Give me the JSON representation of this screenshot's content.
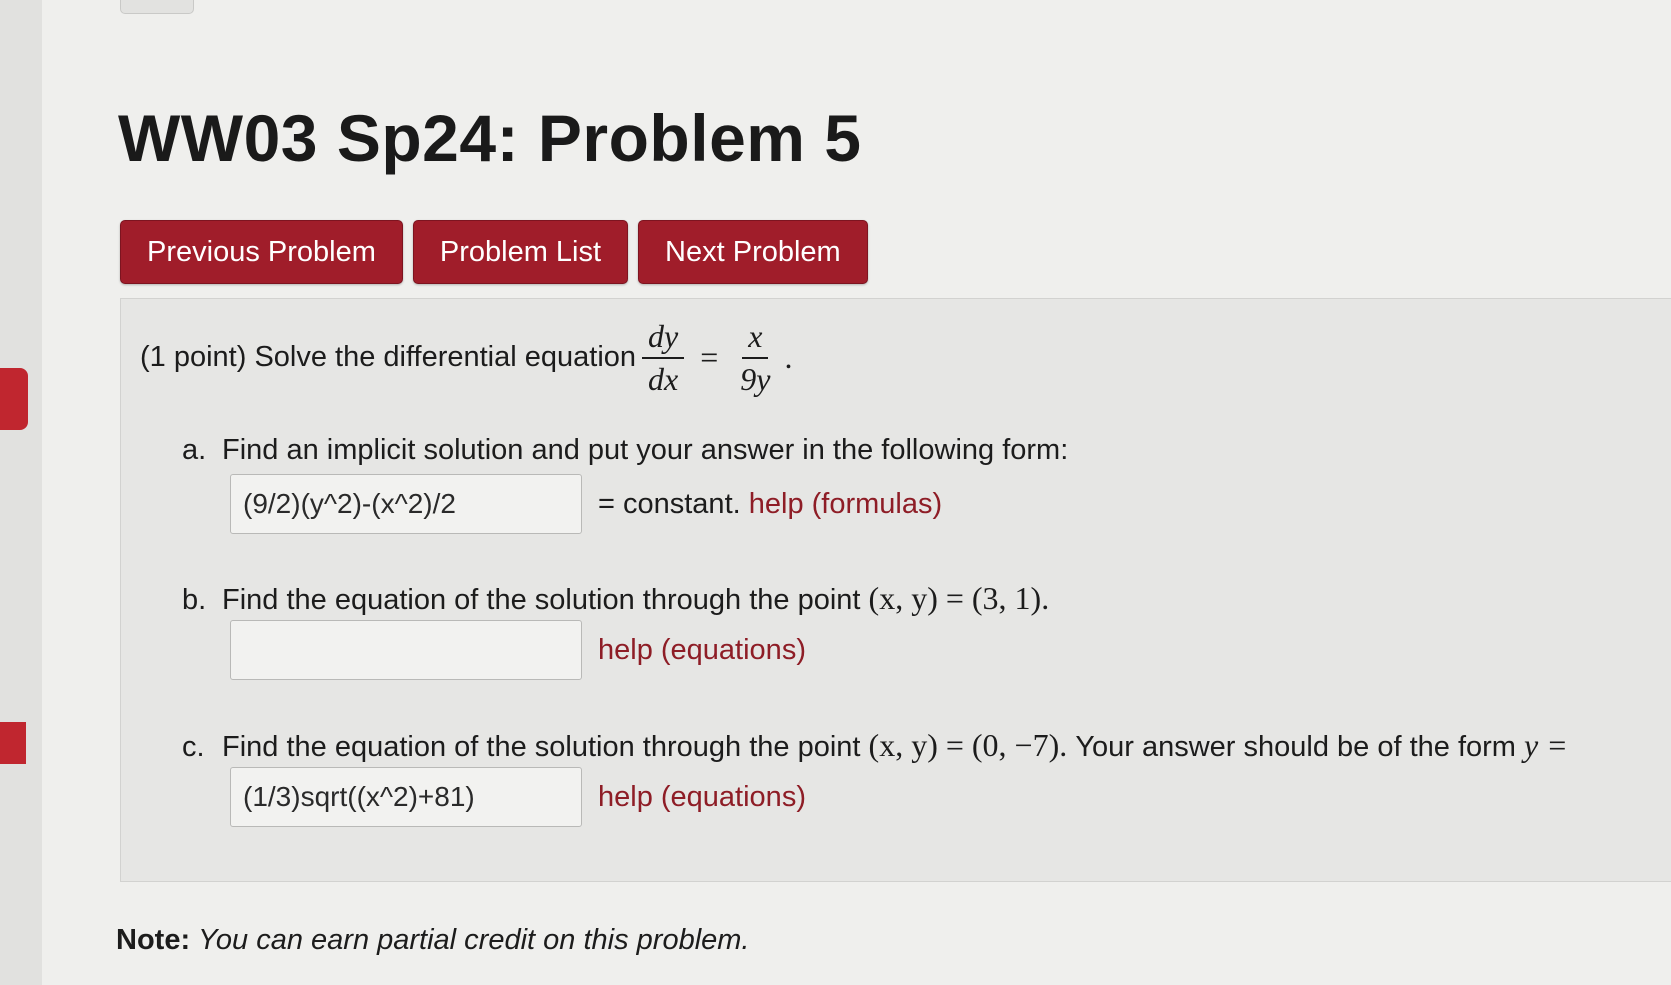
{
  "header": {
    "title": "WW03 Sp24: Problem 5"
  },
  "nav": {
    "previous_label": "Previous Problem",
    "list_label": "Problem List",
    "next_label": "Next Problem"
  },
  "problem": {
    "points": "(1 point)",
    "prompt": "Solve the differential equation",
    "equation": {
      "lhs_num": "dy",
      "lhs_den": "dx",
      "equals": "=",
      "rhs_num": "x",
      "rhs_den": "9y",
      "period": "."
    }
  },
  "part_a": {
    "letter": "a.",
    "text": "Find an implicit solution and put your answer in the following form:",
    "answer_value": "(9/2)(y^2)-(x^2)/2",
    "suffix": "= constant.",
    "help_link": "help (formulas)"
  },
  "part_b": {
    "letter": "b.",
    "text": "Find the equation of the solution through the point",
    "point_expr": "(x, y) = (3, 1).",
    "answer_value": "",
    "help_link": "help (equations)"
  },
  "part_c": {
    "letter": "c.",
    "text": "Find the equation of the solution through the point",
    "point_expr": "(x, y) = (0, −7).",
    "form_text": "Your answer should be of the form",
    "form_expr": "y =",
    "answer_value": "(1/3)sqrt((x^2)+81)",
    "help_link": "help (equations)"
  },
  "note": {
    "label": "Note:",
    "text": "You can earn partial credit on this problem."
  },
  "colors": {
    "button_bg": "#a01d2a",
    "link": "#8e1d26",
    "page_bg": "#efefed"
  }
}
